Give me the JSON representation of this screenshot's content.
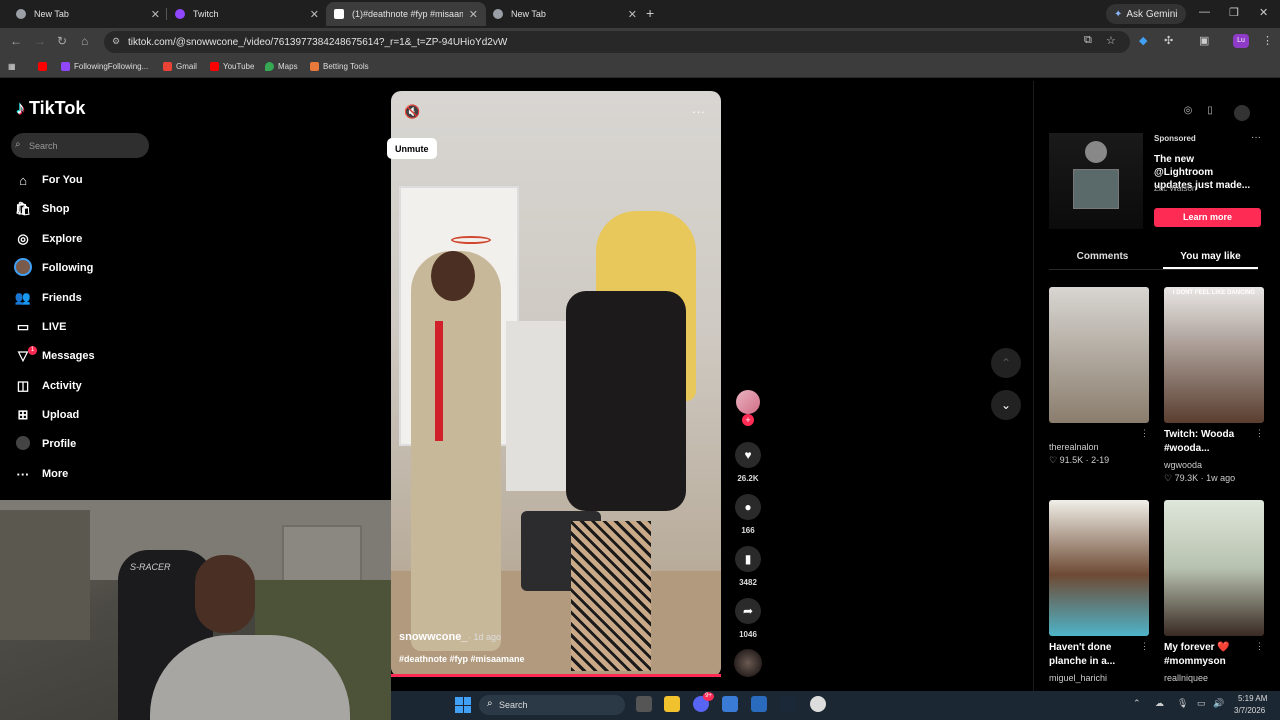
{
  "browser": {
    "tabs": [
      {
        "title": "New Tab",
        "favicon_color": "#9aa0a6",
        "active": false
      },
      {
        "title": "Twitch",
        "favicon_color": "#9146ff",
        "active": false
      },
      {
        "title": "(1)#deathnote #fyp #misaaman",
        "favicon_color": "#111111",
        "active": true
      },
      {
        "title": "New Tab",
        "favicon_color": "#9aa0a6",
        "active": false
      }
    ],
    "new_tab_symbol": "+",
    "gemini_label": "Ask Gemini",
    "url": "tiktok.com/@snowwcone_/video/7613977384248675614?_r=1&_t=ZP-94UHioYd2vW",
    "profile_initials": "Lu",
    "bookmarks": [
      {
        "label": "",
        "color": "#ff0000"
      },
      {
        "label": "FollowingFollowing...",
        "color": "#9146ff"
      },
      {
        "label": "Gmail",
        "color": "#ea4335"
      },
      {
        "label": "YouTube",
        "color": "#ff0000"
      },
      {
        "label": "Maps",
        "color": "#34a853"
      },
      {
        "label": "Betting Tools",
        "color": "#e8793a"
      }
    ]
  },
  "tiktok": {
    "logo_text": "TikTok",
    "search_placeholder": "Search",
    "nav": [
      {
        "label": "For You",
        "icon": "home-icon"
      },
      {
        "label": "Shop",
        "icon": "shop-icon"
      },
      {
        "label": "Explore",
        "icon": "compass-icon"
      },
      {
        "label": "Following",
        "icon": "following-avatar"
      },
      {
        "label": "Friends",
        "icon": "friends-icon"
      },
      {
        "label": "LIVE",
        "icon": "live-icon"
      },
      {
        "label": "Messages",
        "icon": "messages-icon"
      },
      {
        "label": "Activity",
        "icon": "activity-icon"
      },
      {
        "label": "Upload",
        "icon": "upload-icon"
      },
      {
        "label": "Profile",
        "icon": "profile-icon"
      },
      {
        "label": "More",
        "icon": "more-icon"
      }
    ],
    "messages_badge": "1",
    "video": {
      "unmute_tooltip": "Unmute",
      "author": "snowwcone_",
      "posted": "· 1d ago",
      "caption": "#deathnote #fyp #misaamane",
      "likes": "26.2K",
      "comments": "166",
      "saves": "3482",
      "shares": "1046"
    },
    "sponsored": {
      "label": "Sponsored",
      "title": "The new @Lightroom updates just made...",
      "author": "Zac Watson",
      "cta": "Learn more"
    },
    "panel_tabs": {
      "comments": "Comments",
      "you_may_like": "You may like"
    },
    "suggestions": [
      {
        "title": "",
        "author": "therealnalon",
        "stats": "♡ 91.5K · 2-19"
      },
      {
        "title": "Twitch: Wooda #wooda...",
        "author": "wgwooda",
        "stats": "♡ 79.3K · 1w ago"
      },
      {
        "title": "Haven't done planche in a...",
        "author": "miguel_harichi",
        "stats": ""
      },
      {
        "title": "My forever ❤️ #mommyson",
        "author": "reallniquee",
        "stats": ""
      }
    ],
    "suggestion_top_caption": "I DONT FEEL LIKE DANCING"
  },
  "webcam": {
    "chair_text": "S-RACER"
  },
  "taskbar": {
    "search_label": "Search",
    "time": "5:19 AM",
    "date": "3/7/2026",
    "discord_badge": "9+"
  }
}
